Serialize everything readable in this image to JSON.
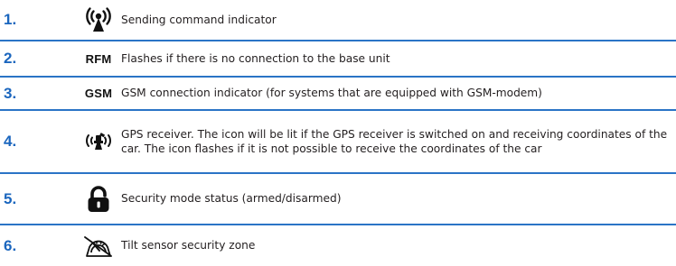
{
  "colors": {
    "accent": "#1b66be",
    "divider": "#2a74c6",
    "text": "#231f20",
    "icon": "#111111"
  },
  "rows": [
    {
      "number": "1.",
      "icon": "antenna-signal-icon",
      "label": "",
      "description": "Sending command indicator"
    },
    {
      "number": "2.",
      "icon": "",
      "label": "RFM",
      "description": "Flashes if there is no connection to the base unit"
    },
    {
      "number": "3.",
      "icon": "",
      "label": "GSM",
      "description": "GSM connection indicator (for systems that are equipped with GSM-modem)"
    },
    {
      "number": "4.",
      "icon": "gps-satellite-icon",
      "label": "",
      "description": "GPS receiver. The icon will be lit if the GPS receiver is switched on and receiving coordinates of the car. The icon flashes if it is not possible to receive the coordinates of the car"
    },
    {
      "number": "5.",
      "icon": "padlock-open-icon",
      "label": "",
      "description": "Security mode status (armed/disarmed)"
    },
    {
      "number": "6.",
      "icon": "tilt-sensor-icon",
      "label": "",
      "description": "Tilt sensor security zone"
    }
  ]
}
